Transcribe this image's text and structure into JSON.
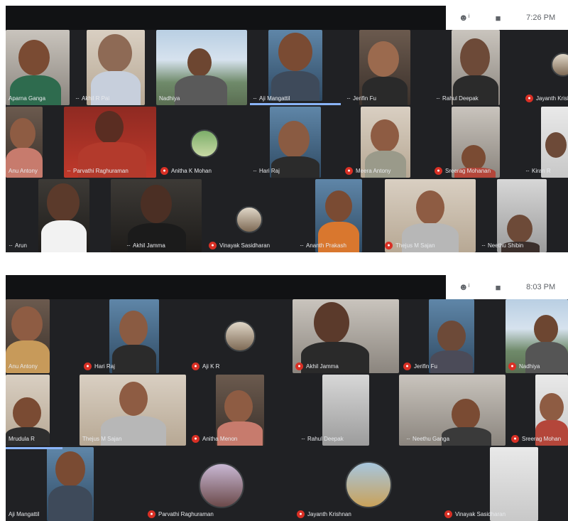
{
  "top": {
    "time": "7:26 PM",
    "tiles": [
      {
        "label": "Aparna Ganga",
        "mic": "dots"
      },
      {
        "label": "Akhil R Pai",
        "mic": "dots"
      },
      {
        "label": "Nadhiya",
        "mic": "none"
      },
      {
        "label": "Aji Mangattil",
        "mic": "dots"
      },
      {
        "label": "Jerifin Fu",
        "mic": "dots"
      },
      {
        "label": "Rahul Deepak",
        "mic": "dots"
      },
      {
        "label": "Jayanth Krishnan",
        "mic": "off"
      },
      {
        "label": "Anu Antony",
        "mic": "none"
      },
      {
        "label": "Parvathi Raghuraman",
        "mic": "dots"
      },
      {
        "label": "Anitha K Mohan",
        "mic": "off"
      },
      {
        "label": "Hari Raj",
        "mic": "dots"
      },
      {
        "label": "Meera Antony",
        "mic": "off"
      },
      {
        "label": "Sreerag Mohanan",
        "mic": "off"
      },
      {
        "label": "Kiran R",
        "mic": "dots"
      },
      {
        "label": "Arun",
        "mic": "dots"
      },
      {
        "label": "Akhil Jamma",
        "mic": "dots"
      },
      {
        "label": "Vinayak Sasidharan",
        "mic": "off"
      },
      {
        "label": "Ananth Prakash",
        "mic": "dots"
      },
      {
        "label": "Thejus M Sajan",
        "mic": "off"
      },
      {
        "label": "Neethu Shibin",
        "mic": "dots"
      }
    ]
  },
  "bottom": {
    "time": "8:03 PM",
    "tiles": [
      {
        "label": "Anu Antony",
        "mic": "none"
      },
      {
        "label": "Hari Raj",
        "mic": "off"
      },
      {
        "label": "Aji K R",
        "mic": "off"
      },
      {
        "label": "Akhil Jamma",
        "mic": "off"
      },
      {
        "label": "Jerifin Fu",
        "mic": "off"
      },
      {
        "label": "Nadhiya",
        "mic": "off"
      },
      {
        "label": "Mrudula R",
        "mic": "none"
      },
      {
        "label": "Thejus M Sajan",
        "mic": "none"
      },
      {
        "label": "Anitha Menon",
        "mic": "off"
      },
      {
        "label": "Rahul Deepak",
        "mic": "dots"
      },
      {
        "label": "Neethu Ganga",
        "mic": "dots"
      },
      {
        "label": "Sreerag Mohan",
        "mic": "off"
      },
      {
        "label": "Aji Mangattil",
        "mic": "none"
      },
      {
        "label": "Parvathi Raghuraman",
        "mic": "off"
      },
      {
        "label": "Jayanth Krishnan",
        "mic": "off"
      },
      {
        "label": "Vinayak Sasidharan",
        "mic": "off"
      }
    ]
  }
}
